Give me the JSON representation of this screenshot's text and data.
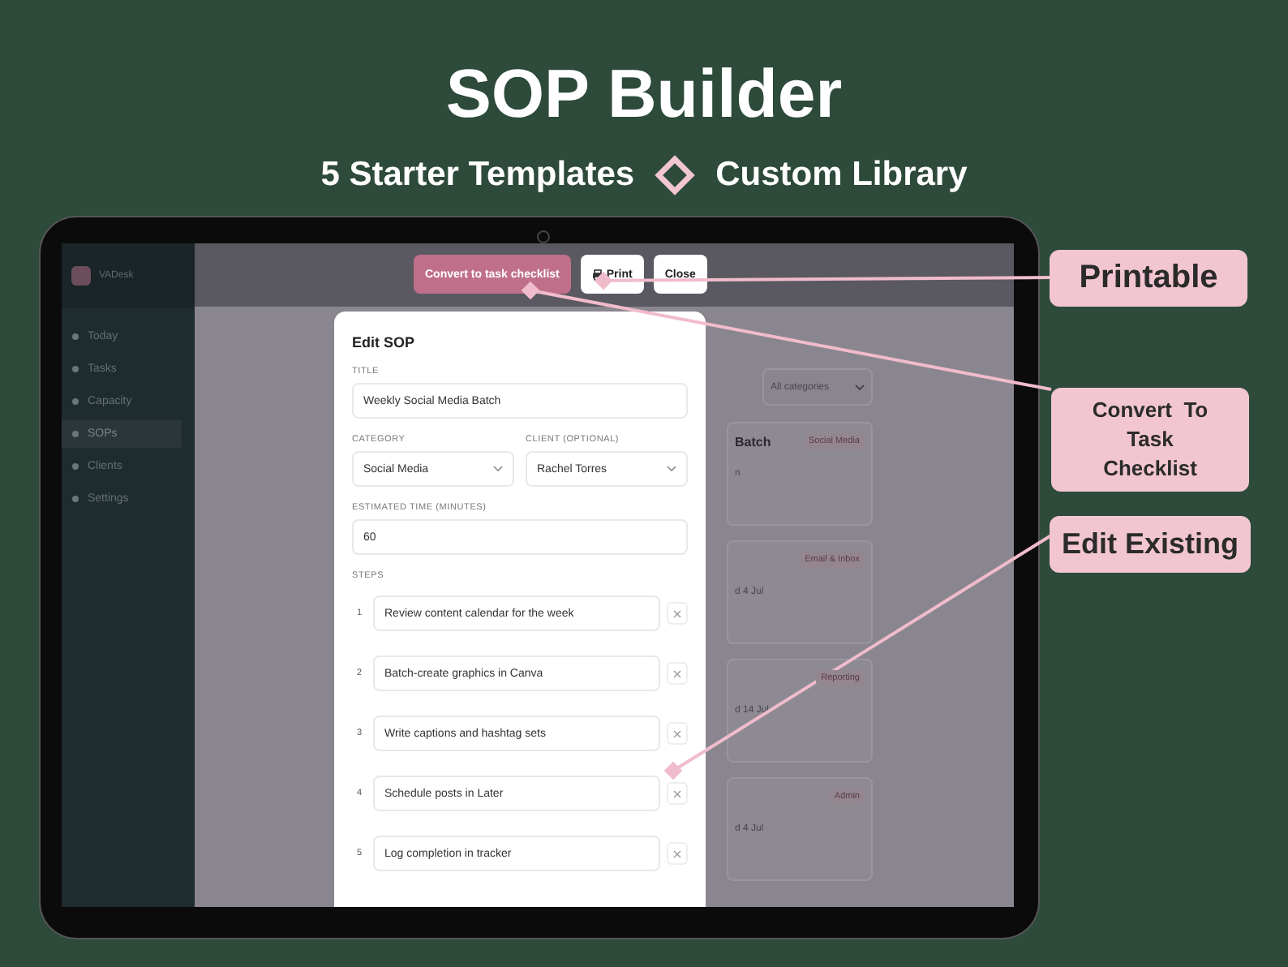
{
  "header": {
    "title": "SOP Builder",
    "subtitle_left": "5 Starter Templates",
    "subtitle_right": "Custom Library"
  },
  "app": {
    "brand": "VADesk",
    "nav": [
      {
        "label": "Today",
        "selected": false
      },
      {
        "label": "Tasks",
        "selected": false
      },
      {
        "label": "Capacity",
        "selected": false
      },
      {
        "label": "SOPs",
        "selected": true
      },
      {
        "label": "Clients",
        "selected": false
      },
      {
        "label": "Settings",
        "selected": false
      }
    ],
    "filter": "All categories",
    "cards": [
      {
        "title": "Batch",
        "meta": "n",
        "tag": "Social Media"
      },
      {
        "meta": "d 4 Jul",
        "tag": "Email & Inbox"
      },
      {
        "meta": "d 14 Jul",
        "tag": "Reporting"
      },
      {
        "meta": "d 4 Jul",
        "tag": "Admin"
      }
    ]
  },
  "toolbar": [
    {
      "kind": "primary",
      "label": "Convert to task checklist"
    },
    {
      "kind": "print",
      "label": "Print"
    },
    {
      "kind": "plain",
      "label": "Close"
    }
  ],
  "modal": {
    "heading": "Edit SOP",
    "title_label": "TITLE",
    "title_value": "Weekly Social Media Batch",
    "category_label": "CATEGORY",
    "category_value": "Social Media",
    "client_label": "CLIENT (OPTIONAL)",
    "client_value": "Rachel Torres",
    "time_label": "ESTIMATED TIME (MINUTES)",
    "time_value": "60",
    "steps_label": "STEPS",
    "steps": [
      {
        "number": "1",
        "text": "Review content calendar for the week"
      },
      {
        "number": "2",
        "text": "Batch-create graphics in Canva"
      },
      {
        "number": "3",
        "text": "Write captions and hashtag sets"
      },
      {
        "number": "4",
        "text": "Schedule posts in Later"
      },
      {
        "number": "5",
        "text": "Log completion in tracker"
      }
    ]
  },
  "callouts": [
    {
      "text": "Printable"
    },
    {
      "text": "Convert  To Task Checklist"
    },
    {
      "text": "Edit Existing"
    }
  ]
}
